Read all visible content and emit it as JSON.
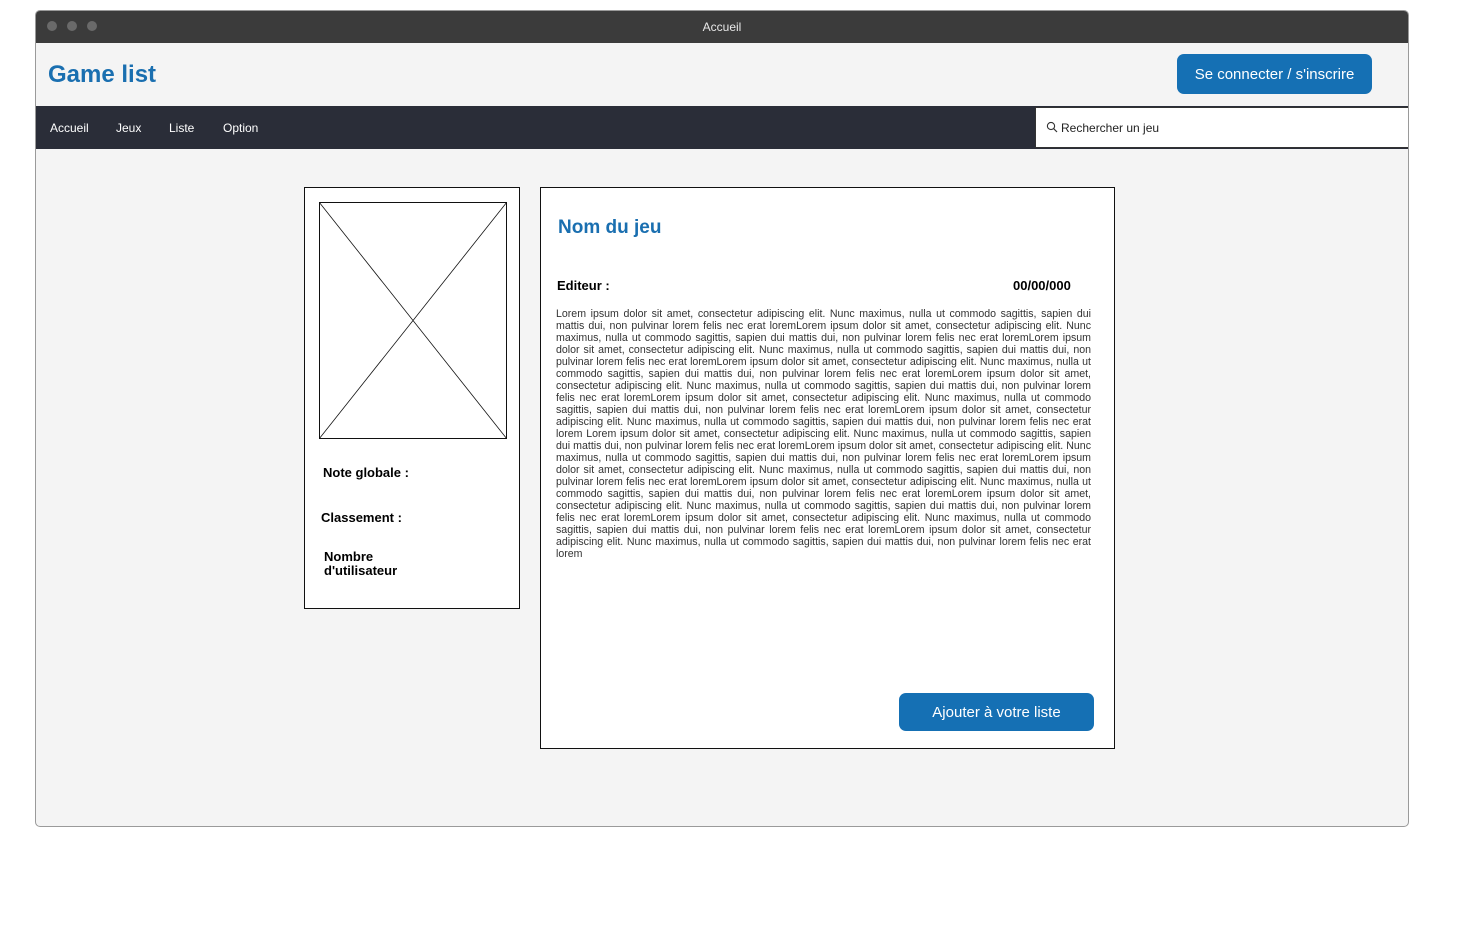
{
  "window": {
    "title": "Accueil"
  },
  "header": {
    "brand": "Game list",
    "login_label": "Se connecter / s'inscrire"
  },
  "nav": {
    "items": [
      "Accueil",
      "Jeux",
      "Liste",
      "Option"
    ]
  },
  "search": {
    "placeholder": "Rechercher un jeu",
    "icon": "search-icon"
  },
  "sidebar_card": {
    "image_icon": "image-placeholder-icon",
    "note_label": "Note globale :",
    "rank_label": "Classement :",
    "users_label": "Nombre d'utilisateur"
  },
  "game": {
    "title": "Nom du jeu",
    "editor_label": "Editeur :",
    "date": "00/00/000",
    "description": "Lorem ipsum dolor sit amet, consectetur adipiscing elit. Nunc maximus, nulla ut commodo sagittis, sapien dui mattis dui, non pulvinar lorem felis nec erat loremLorem ipsum dolor sit amet, consectetur adipiscing elit. Nunc maximus, nulla ut commodo sagittis, sapien dui mattis dui, non pulvinar lorem felis nec erat loremLorem ipsum dolor sit amet, consectetur adipiscing elit. Nunc maximus, nulla ut commodo sagittis, sapien dui mattis dui, non pulvinar lorem felis nec erat loremLorem ipsum dolor sit amet, consectetur adipiscing elit. Nunc maximus, nulla ut commodo sagittis, sapien dui mattis dui, non pulvinar lorem felis nec erat loremLorem ipsum dolor sit amet, consectetur adipiscing elit. Nunc maximus, nulla ut commodo sagittis, sapien dui mattis dui, non pulvinar lorem felis nec erat loremLorem ipsum dolor sit amet, consectetur adipiscing elit. Nunc maximus, nulla ut commodo sagittis, sapien dui mattis dui, non pulvinar lorem felis nec erat loremLorem ipsum dolor sit amet, consectetur adipiscing elit. Nunc maximus, nulla ut commodo sagittis, sapien dui mattis dui, non pulvinar lorem felis nec erat lorem Lorem ipsum dolor sit amet, consectetur adipiscing elit. Nunc maximus, nulla ut commodo sagittis, sapien dui mattis dui, non pulvinar lorem felis nec erat loremLorem ipsum dolor sit amet, consectetur adipiscing elit. Nunc maximus, nulla ut commodo sagittis, sapien dui mattis dui, non pulvinar lorem felis nec erat loremLorem ipsum dolor sit amet, consectetur adipiscing elit. Nunc maximus, nulla ut commodo sagittis, sapien dui mattis dui, non pulvinar lorem felis nec erat loremLorem ipsum dolor sit amet, consectetur adipiscing elit. Nunc maximus, nulla ut commodo sagittis, sapien dui mattis dui, non pulvinar lorem felis nec erat loremLorem ipsum dolor sit amet, consectetur adipiscing elit. Nunc maximus, nulla ut commodo sagittis, sapien dui mattis dui, non pulvinar lorem felis nec erat loremLorem ipsum dolor sit amet, consectetur adipiscing elit. Nunc maximus, nulla ut commodo sagittis, sapien dui mattis dui, non pulvinar lorem felis nec erat loremLorem ipsum dolor sit amet, consectetur adipiscing elit. Nunc maximus, nulla ut commodo sagittis, sapien dui mattis dui, non pulvinar lorem felis nec erat lorem",
    "add_label": "Ajouter à votre liste"
  },
  "colors": {
    "accent": "#1570b4",
    "navbar": "#2a2d38",
    "titlebar": "#3b3b3b",
    "background": "#f4f4f4"
  }
}
